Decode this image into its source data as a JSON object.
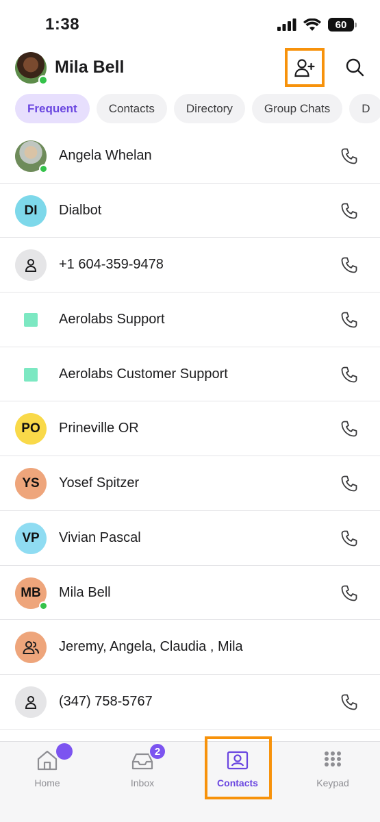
{
  "status_bar": {
    "time": "1:38",
    "battery": "60"
  },
  "header": {
    "user_name": "Mila Bell",
    "add_contact_icon": "person-add-icon",
    "search_icon": "search-icon"
  },
  "tabs": [
    {
      "label": "Frequent",
      "active": true
    },
    {
      "label": "Contacts",
      "active": false
    },
    {
      "label": "Directory",
      "active": false
    },
    {
      "label": "Group Chats",
      "active": false
    },
    {
      "label": "D",
      "active": false
    }
  ],
  "contacts": [
    {
      "name": "Angela Whelan",
      "avatar_type": "photo",
      "initials": "",
      "avatar_color": "",
      "online": true,
      "has_call": true
    },
    {
      "name": "Dialbot",
      "avatar_type": "initials",
      "initials": "DI",
      "avatar_color": "#7dd8ea",
      "online": false,
      "has_call": true
    },
    {
      "name": "+1 604-359-9478",
      "avatar_type": "person",
      "initials": "",
      "avatar_color": "#e5e5e7",
      "online": false,
      "has_call": true
    },
    {
      "name": "Aerolabs Support",
      "avatar_type": "square",
      "initials": "",
      "avatar_color": "#7ce8c2",
      "online": false,
      "has_call": true
    },
    {
      "name": "Aerolabs Customer Support",
      "avatar_type": "square",
      "initials": "",
      "avatar_color": "#7ce8c2",
      "online": false,
      "has_call": true
    },
    {
      "name": "Prineville OR",
      "avatar_type": "initials",
      "initials": "PO",
      "avatar_color": "#f9d949",
      "online": false,
      "has_call": true
    },
    {
      "name": "Yosef Spitzer",
      "avatar_type": "initials",
      "initials": "YS",
      "avatar_color": "#eea57b",
      "online": false,
      "has_call": true
    },
    {
      "name": "Vivian Pascal",
      "avatar_type": "initials",
      "initials": "VP",
      "avatar_color": "#8fdcf2",
      "online": false,
      "has_call": true
    },
    {
      "name": "Mila Bell",
      "avatar_type": "initials",
      "initials": "MB",
      "avatar_color": "#eea57b",
      "online": true,
      "has_call": true
    },
    {
      "name": "Jeremy, Angela, Claudia , Mila",
      "avatar_type": "group",
      "initials": "",
      "avatar_color": "#eea57b",
      "online": false,
      "has_call": false
    },
    {
      "name": "(347) 758-5767",
      "avatar_type": "person",
      "initials": "",
      "avatar_color": "#e5e5e7",
      "online": false,
      "has_call": true
    }
  ],
  "tabbar": [
    {
      "label": "Home",
      "icon": "home-icon",
      "active": false,
      "badge": ""
    },
    {
      "label": "Inbox",
      "icon": "inbox-icon",
      "active": false,
      "badge": "2"
    },
    {
      "label": "Contacts",
      "icon": "contacts-icon",
      "active": true,
      "badge": ""
    },
    {
      "label": "Keypad",
      "icon": "keypad-icon",
      "active": false,
      "badge": ""
    }
  ],
  "colors": {
    "accent": "#6a46e0",
    "highlight": "#f7920b",
    "online": "#34c24a"
  }
}
